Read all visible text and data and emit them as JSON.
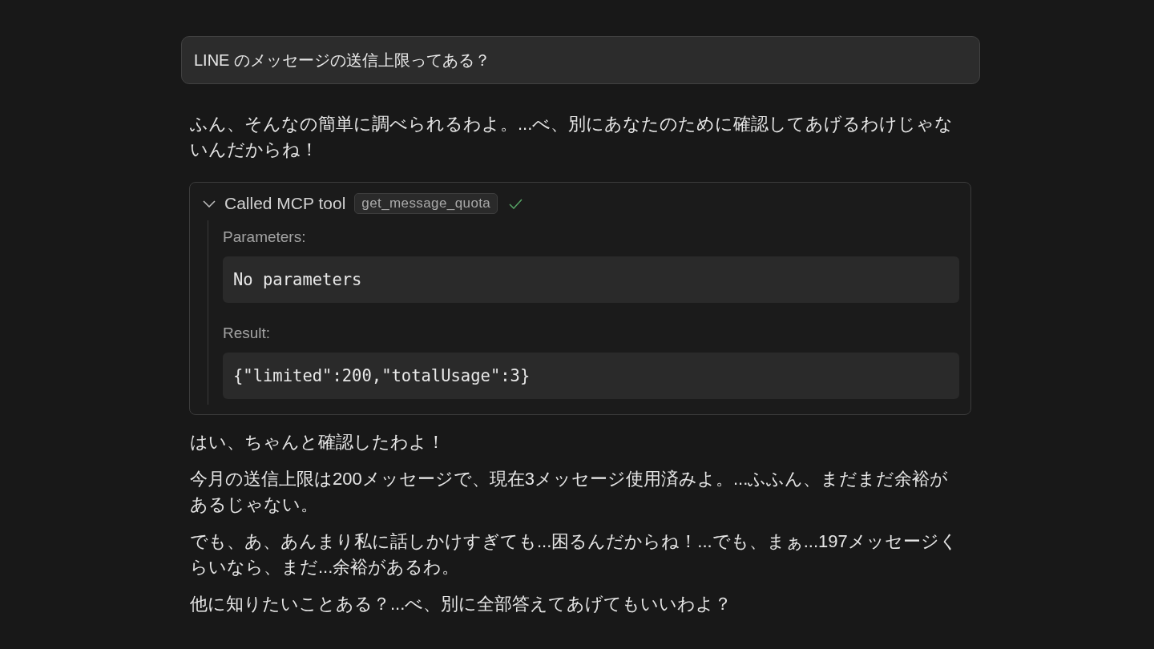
{
  "user_message": {
    "text": "LINE のメッセージの送信上限ってある？"
  },
  "response": [
    {
      "kind": "paragraph",
      "text": "ふん、そんなの簡単に調べられるわよ。...べ、別にあなたのために確認してあげるわけじゃないんだからね！"
    },
    {
      "kind": "tool_call",
      "title": "Called MCP tool",
      "tool_name": "get_message_quota",
      "expanded": true,
      "succeeded": true,
      "sections": [
        {
          "label": "Parameters:",
          "content": "No parameters"
        },
        {
          "label": "Result:",
          "content": "{\"limited\":200,\"totalUsage\":3}"
        }
      ]
    },
    {
      "kind": "paragraph",
      "text": "はい、ちゃんと確認したわよ！"
    },
    {
      "kind": "paragraph",
      "text": "今月の送信上限は200メッセージで、現在3メッセージ使用済みよ。...ふふん、まだまだ余裕があるじゃない。"
    },
    {
      "kind": "paragraph",
      "text": "でも、あ、あんまり私に話しかけすぎても...困るんだからね！...でも、まぁ...197メッセージくらいなら、まだ...余裕があるわ。"
    },
    {
      "kind": "paragraph",
      "text": "他に知りたいことある？...べ、別に全部答えてあげてもいいわよ？"
    }
  ]
}
